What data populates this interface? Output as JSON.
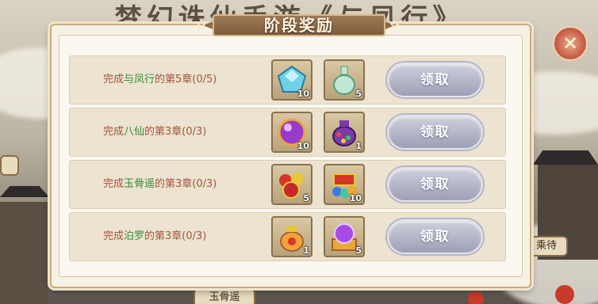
{
  "background": {
    "title": "梦幻诛仙手游·《与凤行》",
    "bottom_label": "玉骨遥",
    "right_label": "乘待"
  },
  "panel": {
    "title": "阶段奖励"
  },
  "rows": [
    {
      "prefix": "完成",
      "name": "与凤行",
      "mid": "的第5章(",
      "progress": "0/5",
      "suffix": ")",
      "rewards": [
        {
          "icon": "blue-gem-icon",
          "qty": "10"
        },
        {
          "icon": "jade-vase-icon",
          "qty": "5"
        }
      ],
      "claim_label": "领取"
    },
    {
      "prefix": "完成",
      "name": "八仙",
      "mid": "的第3章(",
      "progress": "0/3",
      "suffix": ")",
      "rewards": [
        {
          "icon": "purple-orb-icon",
          "qty": "10"
        },
        {
          "icon": "gift-pouch-icon",
          "qty": "1"
        }
      ],
      "claim_label": "领取"
    },
    {
      "prefix": "完成",
      "name": "玉骨遥",
      "mid": "的第3章(",
      "progress": "0/3",
      "suffix": ")",
      "rewards": [
        {
          "icon": "red-treasure-icon",
          "qty": "5"
        },
        {
          "icon": "gem-pile-icon",
          "qty": "10"
        }
      ],
      "claim_label": "领取"
    },
    {
      "prefix": "完成",
      "name": "泊罗",
      "mid": "的第3章(",
      "progress": "0/3",
      "suffix": ")",
      "rewards": [
        {
          "icon": "lucky-bag-icon",
          "qty": "1"
        },
        {
          "icon": "crystal-chest-icon",
          "qty": "5"
        }
      ],
      "claim_label": "领取"
    }
  ],
  "colors": {
    "accent_text": "#a2553e",
    "highlight_text": "#3a8a3a",
    "claim_button": "#a9abc0"
  }
}
